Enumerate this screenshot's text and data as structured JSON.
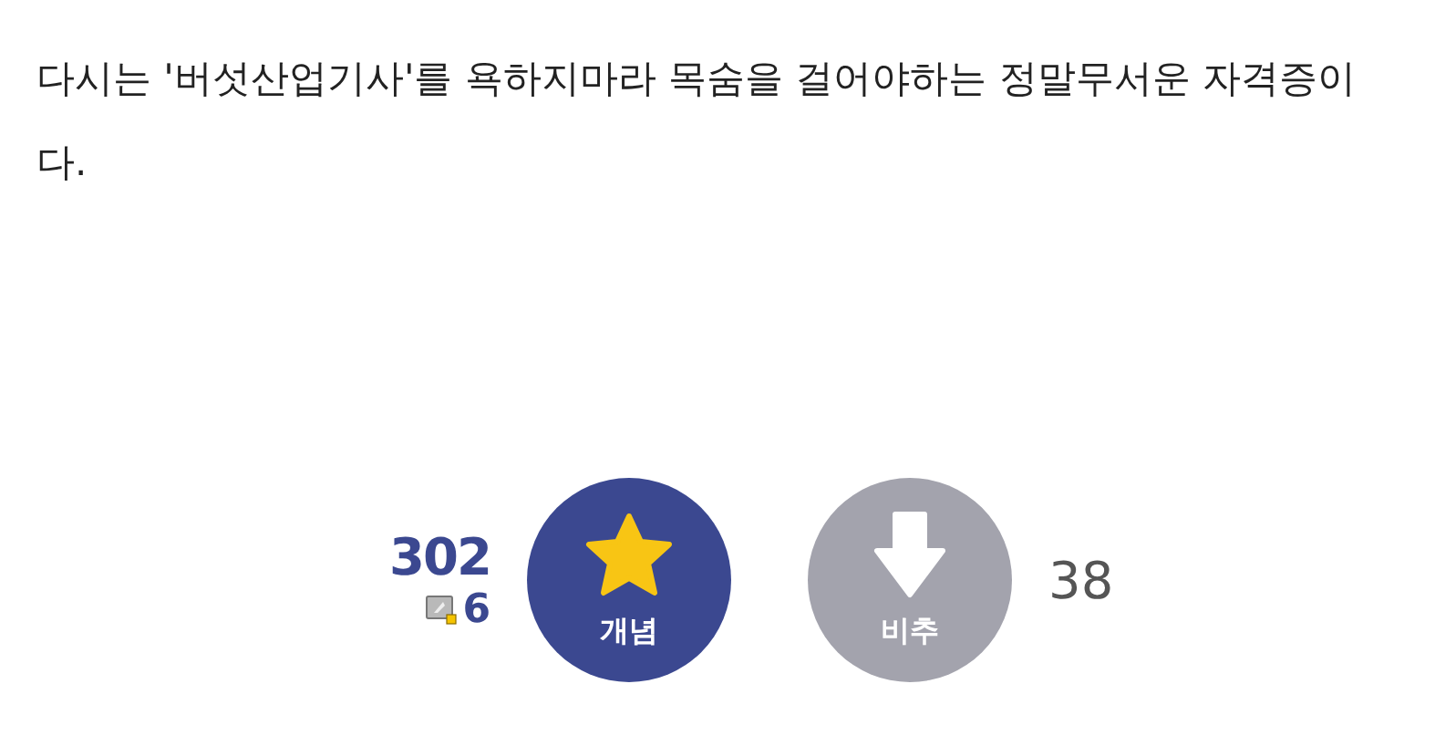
{
  "post": {
    "body": "다시는 '버섯산업기사'를 욕하지마라 목숨을 걸어야하는 정말무서운 자격증이다."
  },
  "votes": {
    "upvote_count": "302",
    "fixed_count": "6",
    "upvote_label": "개념",
    "downvote_label": "비추",
    "downvote_count": "38"
  }
}
